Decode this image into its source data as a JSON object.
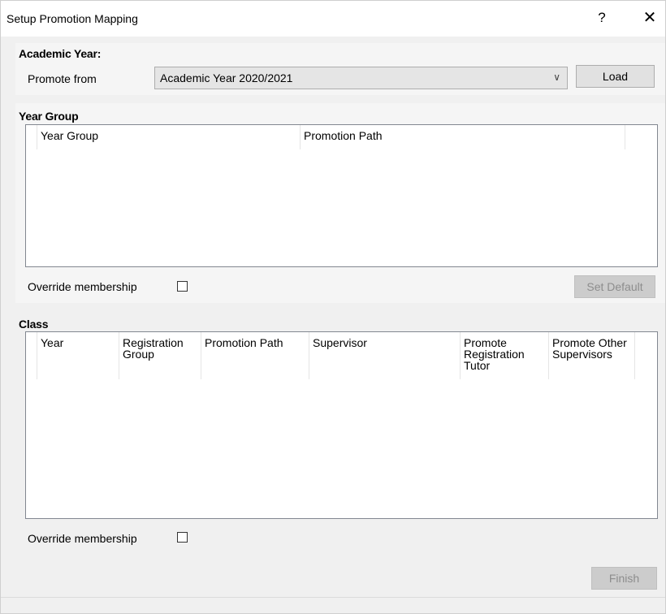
{
  "window": {
    "title": "Setup Promotion Mapping",
    "help_label": "?",
    "close_label": "✕"
  },
  "academic_year": {
    "heading": "Academic Year:",
    "promote_from_label": "Promote from",
    "selected": "Academic Year 2020/2021",
    "chevron": "∨",
    "load_label": "Load"
  },
  "year_group": {
    "heading": "Year Group",
    "columns": [
      "Year Group",
      "Promotion Path"
    ],
    "override_label": "Override membership",
    "override_checked": false,
    "set_default_label": "Set Default"
  },
  "class": {
    "heading": "Class",
    "columns": [
      "Year",
      "Registration Group",
      "Promotion Path",
      "Supervisor",
      "Promote Registration Tutor",
      "Promote Other Supervisors"
    ],
    "override_label": "Override membership",
    "override_checked": false
  },
  "footer": {
    "finish_label": "Finish"
  }
}
